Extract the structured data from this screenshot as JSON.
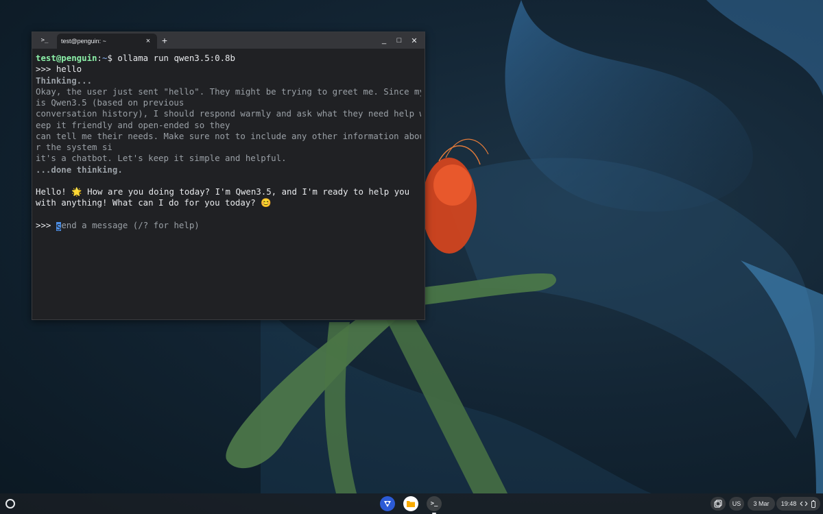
{
  "terminal": {
    "app_icon_label": ">_",
    "tab_title": "test@penguin: ~",
    "tab_close": "×",
    "new_tab": "+",
    "controls": {
      "minimize": "_",
      "maximize": "□",
      "close": "✕"
    },
    "lines": {
      "l1_user": "test@penguin",
      "l1_colon": ":",
      "l1_path": "~",
      "l1_cmd": "$ ollama run qwen3.5:0.8b",
      "l2": ">>> hello",
      "l3": "Thinking...",
      "l4": "Okay, the user just sent \"hello\". They might be trying to greet me. Since my name",
      "l5": "is Qwen3.5 (based on previous",
      "l6": "conversation history), I should respond warmly and ask what they need help with. K",
      "l7": "eep it friendly and open-ended so they",
      "l8": "can tell me their needs. Make sure not to include any other information about me o",
      "l9": "r the system si",
      "l10": "it's a chatbot. Let's keep it simple and helpful.",
      "l11": "...done thinking.",
      "l12": "",
      "l13": "Hello! 🌟 How are you doing today? I'm Qwen3.5, and I'm ready to help you",
      "l14": "with anything! What can I do for you today? 😊",
      "l15": "",
      "prompt_prefix": ">>> ",
      "cursor_char": "S",
      "placeholder_rest": "end a message (/? for help)"
    }
  },
  "shelf": {
    "terminal_icon_label": ">_",
    "ime": "US",
    "date": "3 Mar",
    "time": "19:48"
  },
  "colors": {
    "terminal_bg": "#202124",
    "titlebar_bg": "#35363a",
    "prompt_user": "#8cf0a8",
    "prompt_path": "#8ab4f8",
    "dim_text": "#9aa0a6",
    "cursor": "#4d8fe6"
  },
  "icons": {
    "launcher": "launcher-circle-icon",
    "chrome": "chrome-icon",
    "files": "files-icon",
    "terminal": "terminal-icon",
    "holding_space": "holding-space-icon",
    "network": "network-icon",
    "battery": "battery-icon"
  }
}
